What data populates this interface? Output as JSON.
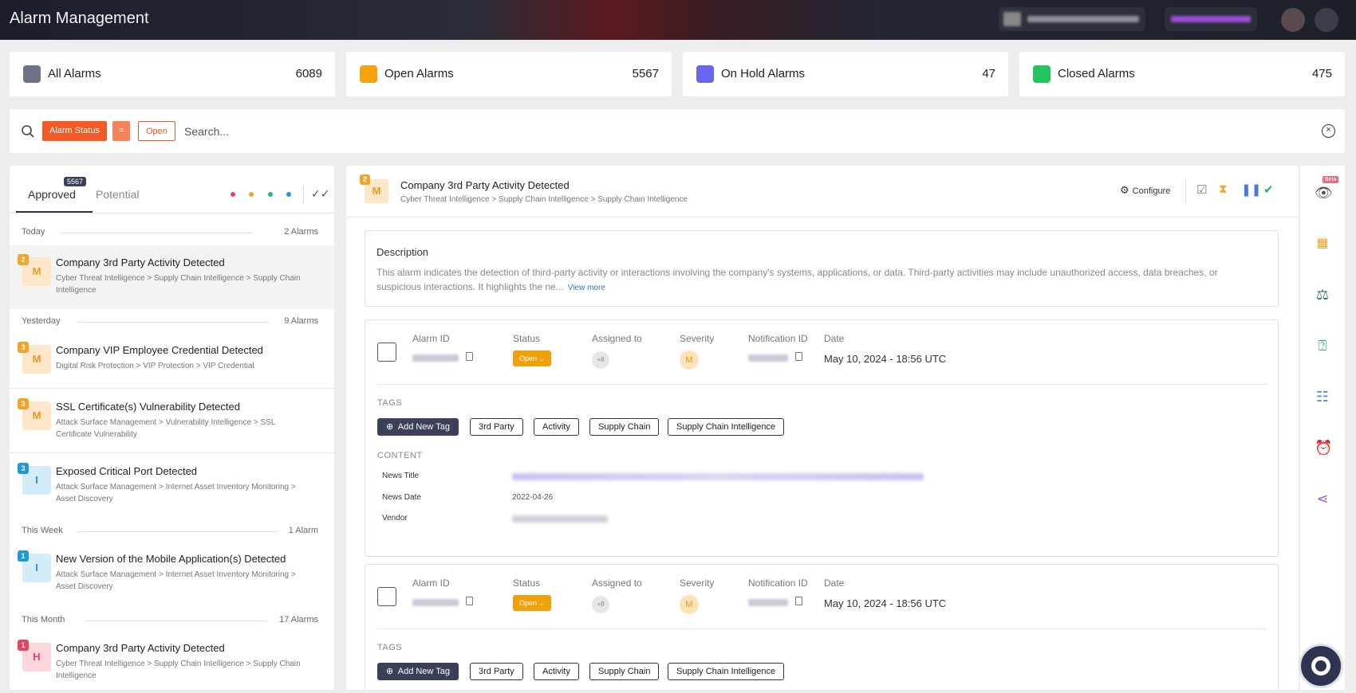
{
  "app": {
    "title": "Alarm Management"
  },
  "stats": [
    {
      "label": "All Alarms",
      "count": "6089",
      "color": "#6b7385"
    },
    {
      "label": "Open Alarms",
      "count": "5567",
      "color": "#f5a30b"
    },
    {
      "label": "On Hold Alarms",
      "count": "47",
      "color": "#6a66f0"
    },
    {
      "label": "Closed Alarms",
      "count": "475",
      "color": "#22c55e"
    }
  ],
  "search": {
    "filter_field": "Alarm Status",
    "filter_operator": "=",
    "filter_value": "Open",
    "placeholder": "Search...",
    "value": ""
  },
  "left_panel": {
    "tabs": [
      {
        "label": "Approved",
        "badge": "5567",
        "active": true
      },
      {
        "label": "Potential",
        "active": false
      }
    ],
    "dot_colors": [
      "#e9455a",
      "#f0a42a",
      "#1fb880",
      "#1e9bd6"
    ],
    "groups": [
      {
        "name": "Today",
        "count": "2 Alarms"
      },
      {
        "name": "Yesterday",
        "count": "9 Alarms"
      },
      {
        "name": "This Week",
        "count": "1 Alarm"
      },
      {
        "name": "This Month",
        "count": "17 Alarms"
      }
    ],
    "alarms": [
      {
        "num": "2",
        "letter": "M",
        "title": "Company 3rd Party Activity Detected",
        "path": "Cyber Threat Intelligence > Supply Chain Intelligence > Supply Chain Intelligence",
        "level_color": "#f0a42a",
        "bg": "#fde7c8"
      },
      {
        "num": "3",
        "letter": "M",
        "title": "Company VIP Employee Credential Detected",
        "path": "Digital Risk Protection > VIP Protection > VIP Credential",
        "level_color": "#f0a42a",
        "bg": "#fde7c8"
      },
      {
        "num": "3",
        "letter": "M",
        "title": "SSL Certificate(s) Vulnerability Detected",
        "path": "Attack Surface Management > Vulnerability Intelligence > SSL Certificate Vulnerability",
        "level_color": "#f0a42a",
        "bg": "#fde7c8"
      },
      {
        "num": "3",
        "letter": "I",
        "title": "Exposed Critical Port Detected",
        "path": "Attack Surface Management > Internet Asset Inventory Monitoring > Asset Discovery",
        "level_color": "#1e9bd6",
        "bg": "#d3ecf8"
      },
      {
        "num": "1",
        "letter": "I",
        "title": "New Version of the Mobile Application(s) Detected",
        "path": "Attack Surface Management > Internet Asset Inventory Monitoring > Asset Discovery",
        "level_color": "#1e9bd6",
        "bg": "#d3ecf8"
      },
      {
        "num": "1",
        "letter": "H",
        "title": "Company 3rd Party Activity Detected",
        "path": "Cyber Threat Intelligence > Supply Chain Intelligence > Supply Chain Intelligence",
        "level_color": "#e9455a",
        "bg": "#fbd6dc"
      }
    ]
  },
  "detail": {
    "num": "2",
    "letter": "M",
    "title": "Company 3rd Party Activity Detected",
    "path": "Cyber Threat Intelligence > Supply Chain Intelligence > Supply Chain Intelligence",
    "configure_label": "Configure",
    "description_title": "Description",
    "description_text": "This alarm indicates the detection of third-party activity or interactions involving the company's systems, applications, or data. Third-party activities may include unauthorized access, data breaches, or suspicious interactions. It highlights the ne...",
    "view_more": "View more",
    "field_labels": {
      "alarm_id": "Alarm ID",
      "status": "Status",
      "assigned": "Assigned to",
      "severity": "Severity",
      "notification_id": "Notification ID",
      "date": "Date"
    },
    "cards": [
      {
        "status": "Open",
        "severity": "M",
        "date": "May 10, 2024 - 18:56 UTC",
        "tags_label": "TAGS",
        "add_tag": "Add New Tag",
        "tags": [
          "3rd Party",
          "Activity",
          "Supply Chain",
          "Supply Chain Intelligence"
        ],
        "content_label": "CONTENT",
        "content_rows": [
          {
            "label": "News Title"
          },
          {
            "label": "News Date",
            "value": "2022-04-26"
          },
          {
            "label": "Vendor"
          }
        ]
      },
      {
        "status": "Open",
        "severity": "M",
        "date": "May 10, 2024 - 18:56 UTC",
        "tags_label": "TAGS",
        "add_tag": "Add New Tag",
        "tags": [
          "3rd Party",
          "Activity",
          "Supply Chain",
          "Supply Chain Intelligence"
        ]
      }
    ]
  },
  "rail": {
    "beta": "Beta",
    "icons": [
      "eye-icon",
      "grid-icon",
      "scale-icon",
      "question-chat-icon",
      "comments-icon",
      "alarm-clock-icon",
      "share-icon"
    ]
  }
}
